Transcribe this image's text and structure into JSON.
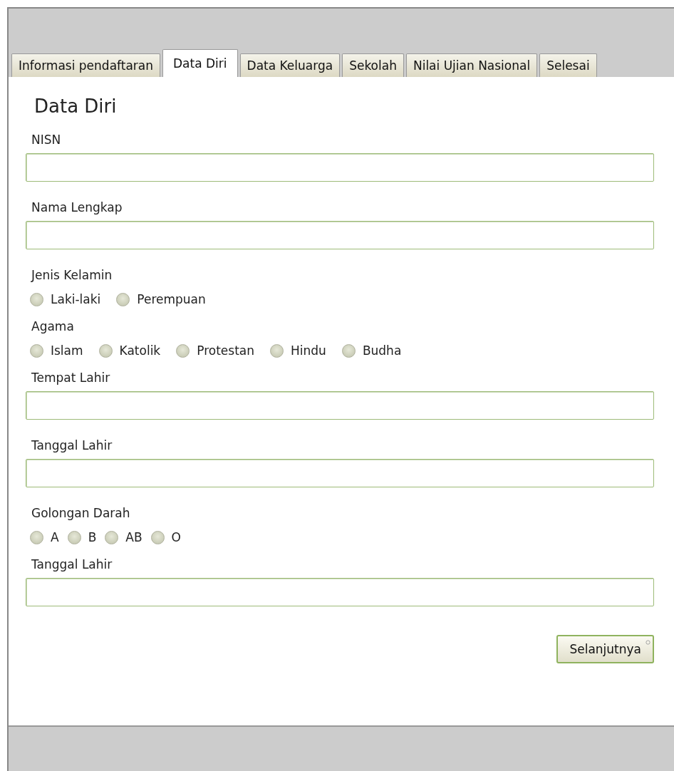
{
  "tabs": [
    {
      "label": "Informasi pendaftaran",
      "selected": false
    },
    {
      "label": "Data Diri",
      "selected": true
    },
    {
      "label": "Data Keluarga",
      "selected": false
    },
    {
      "label": "Sekolah",
      "selected": false
    },
    {
      "label": "Nilai Ujian Nasional",
      "selected": false
    },
    {
      "label": "Selesai",
      "selected": false
    }
  ],
  "heading": "Data Diri",
  "fields": [
    {
      "kind": "text",
      "label": "NISN"
    },
    {
      "kind": "text",
      "label": "Nama Lengkap"
    },
    {
      "kind": "radio",
      "label": "Jenis Kelamin",
      "options": [
        {
          "label": "Laki-laki",
          "selected": false
        },
        {
          "label": "Perempuan",
          "selected": false
        }
      ]
    },
    {
      "kind": "radio",
      "label": "Agama",
      "options": [
        {
          "label": "Islam",
          "selected": false
        },
        {
          "label": "Katolik",
          "selected": false
        },
        {
          "label": "Protestan",
          "selected": false
        },
        {
          "label": "Hindu",
          "selected": false
        },
        {
          "label": "Budha",
          "selected": false
        }
      ]
    },
    {
      "kind": "text",
      "label": "Tempat Lahir"
    },
    {
      "kind": "text",
      "label": "Tanggal Lahir"
    },
    {
      "kind": "radio",
      "label": "Golongan Darah",
      "options": [
        {
          "label": "A",
          "selected": false
        },
        {
          "label": "B",
          "selected": false
        },
        {
          "label": "AB",
          "selected": false
        },
        {
          "label": "O",
          "selected": false
        }
      ]
    },
    {
      "kind": "text",
      "label": "Tanggal Lahir"
    }
  ],
  "next_button": "Selanjutnya"
}
